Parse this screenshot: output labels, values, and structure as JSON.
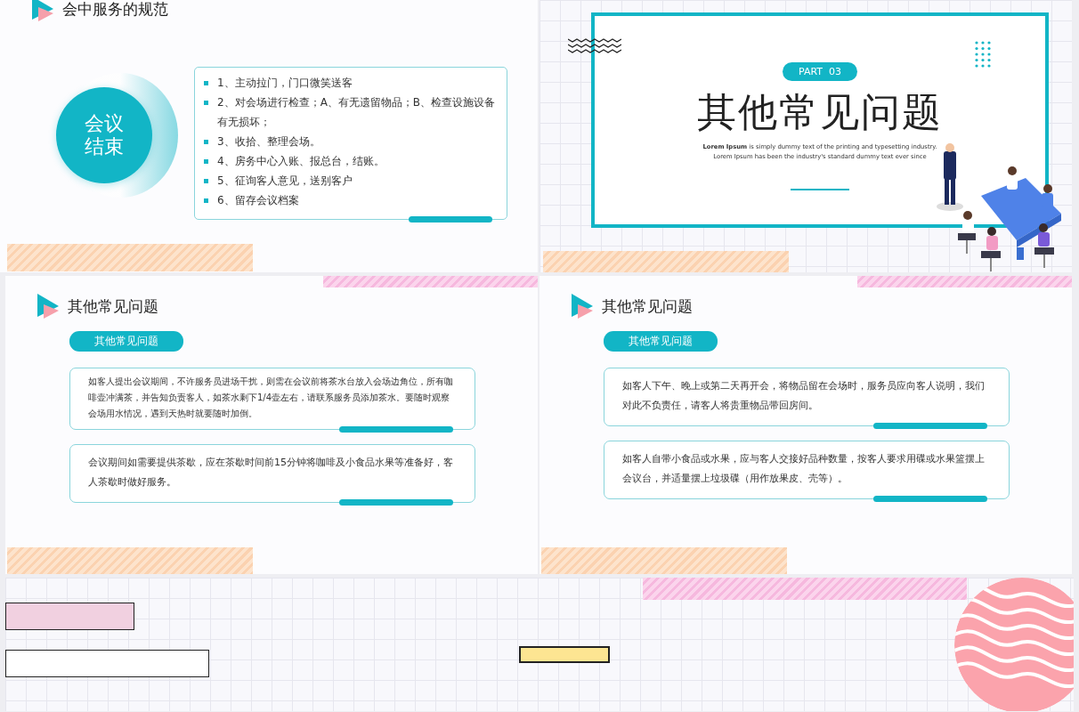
{
  "slides": [
    {
      "kind": "list",
      "title": "会中服务的规范",
      "circle_lines": [
        "会议",
        "结束"
      ],
      "items": [
        "1、主动拉门，门口微笑送客",
        "2、对会场进行检查；A、有无遗留物品；B、检查设施设备有无损坏；",
        "3、收拾、整理会场。",
        "4、房务中心入账、报总台，结账。",
        "5、征询客人意见，送别客户",
        "6、留存会议档案"
      ]
    },
    {
      "kind": "cover",
      "badge": "PART  03",
      "title": "其他常见问题",
      "subtitle": "**Lorem Ipsum** is simply dummy text of the printing and typesetting industry. Lorem Ipsum has been the industry's standard dummy text ever since"
    },
    {
      "kind": "qa",
      "title": "其他常见问题",
      "tag": "其他常见问题",
      "cards": [
        {
          "text": "如客人提出会议期间，不许服务员进场干扰，则需在会议前将茶水台放入会场边角位，所有咖啡壶冲满茶，并告知负责客人，如茶水剩下1/4壶左右，请联系服务员添加茶水。要随时观察会场用水情况，遇到天热时就要随时加倒。",
          "small": true
        },
        {
          "text": "会议期间如需要提供茶歇，应在茶歇时间前15分钟将咖啡及小食品水果等准备好，客人茶歇时做好服务。",
          "small": false
        }
      ]
    },
    {
      "kind": "qa",
      "title": "其他常见问题",
      "tag": "其他常见问题",
      "cards": [
        {
          "text": "如客人下午、晚上或第二天再开会，将物品留在会场时，服务员应向客人说明，我们对此不负责任，请客人将贵重物品带回房间。",
          "small": false
        },
        {
          "text": "如客人自带小食品或水果，应与客人交接好品种数量，按客人要求用碟或水果篮摆上会议台，并适量摆上垃圾碟（用作放果皮、壳等）。",
          "small": false
        }
      ]
    },
    {
      "kind": "deco"
    }
  ]
}
